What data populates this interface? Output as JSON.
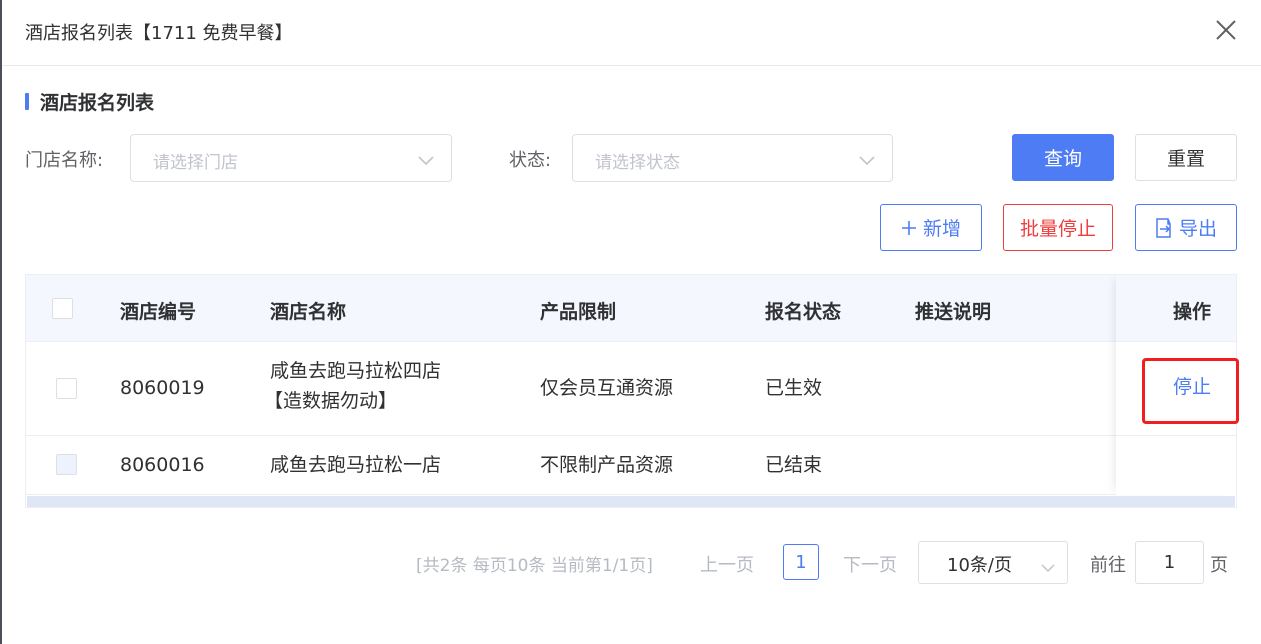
{
  "dialog": {
    "title": "酒店报名列表【1711 免费早餐】"
  },
  "section": {
    "title": "酒店报名列表"
  },
  "filters": {
    "store_label": "门店名称:",
    "store_placeholder": "请选择门店",
    "status_label": "状态:",
    "status_placeholder": "请选择状态",
    "query_label": "查询",
    "reset_label": "重置"
  },
  "actions": {
    "add_label": "新增",
    "batch_stop_label": "批量停止",
    "export_label": "导出"
  },
  "table": {
    "headers": {
      "code": "酒店编号",
      "name": "酒店名称",
      "limit": "产品限制",
      "status": "报名状态",
      "note": "推送说明",
      "op": "操作"
    },
    "rows": [
      {
        "code": "8060019",
        "name_line1": "咸鱼去跑马拉松四店",
        "name_line2": "【造数据勿动】",
        "limit": "仅会员互通资源",
        "status": "已生效",
        "note": "",
        "op": "停止"
      },
      {
        "code": "8060016",
        "name_line1": "咸鱼去跑马拉松一店",
        "name_line2": "",
        "limit": "不限制产品资源",
        "status": "已结束",
        "note": "",
        "op": ""
      }
    ]
  },
  "pagination": {
    "total_text": "[共2条 每页10条 当前第1/1页]",
    "prev_label": "上一页",
    "current_page": "1",
    "next_label": "下一页",
    "page_size": "10条/页",
    "goto_label": "前往",
    "goto_value": "1",
    "page_suffix": "页"
  },
  "colors": {
    "primary": "#4d7cf5",
    "danger": "#f03c3c",
    "highlight": "#f01e1e"
  },
  "icons": {
    "close": "close-icon",
    "dropdown": "chevron-down-icon",
    "add": "plus-icon",
    "export": "export-icon"
  }
}
